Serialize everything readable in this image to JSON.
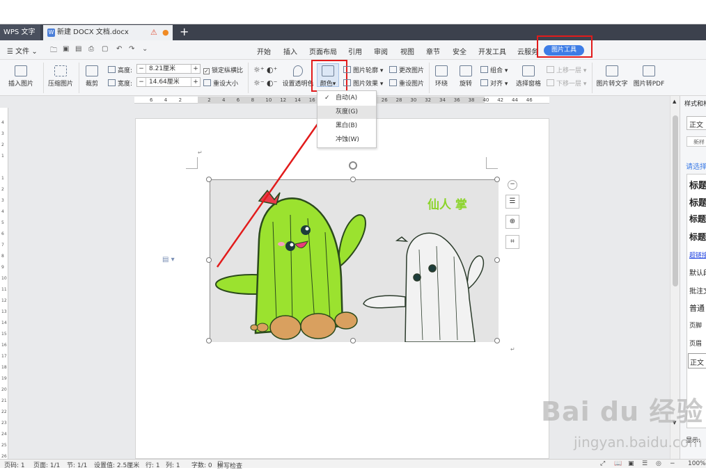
{
  "app": {
    "name": "WPS 文字"
  },
  "document_tab": {
    "title": "新建 DOCX 文档.docx",
    "icon": "W"
  },
  "menubar": {
    "file_label": "文件",
    "tabs": [
      "开始",
      "插入",
      "页面布局",
      "引用",
      "审阅",
      "视图",
      "章节",
      "安全",
      "开发工具",
      "云服务"
    ],
    "active_tab": "图片工具"
  },
  "ribbon": {
    "insert_picture": "插入图片",
    "compress_picture": "压缩图片",
    "crop": "裁剪",
    "height_label": "高度:",
    "height_value": "8.21厘米",
    "width_label": "宽度:",
    "width_value": "14.64厘米",
    "lock_ratio": "锁定纵横比",
    "reset_size": "重设大小",
    "transparent": "设置透明色",
    "color": "颜色",
    "picture_outline": "图片轮廓",
    "picture_effect": "图片效果",
    "change_picture": "更改图片",
    "reset_picture": "重设图片",
    "wrap": "环绕",
    "rotate": "旋转",
    "group": "组合",
    "align": "对齐",
    "selection_pane": "选择窗格",
    "bring_forward": "上移一层",
    "send_backward": "下移一层",
    "to_text": "图片转文字",
    "to_pdf": "图片转PDF"
  },
  "color_menu": {
    "items": [
      "自动(A)",
      "灰度(G)",
      "黑白(B)",
      "冲蚀(W)"
    ],
    "checked_index": 0,
    "highlight_index": 1
  },
  "ruler": {
    "h_ticks": [
      "6",
      "4",
      "2",
      "",
      "2",
      "4",
      "6",
      "8",
      "10",
      "12",
      "14",
      "16",
      "18",
      "20",
      "22",
      "24",
      "26",
      "28",
      "30",
      "32",
      "34",
      "36",
      "38",
      "40",
      "42",
      "44",
      "46"
    ],
    "v_ticks": [
      "4",
      "3",
      "2",
      "1",
      "",
      "1",
      "2",
      "3",
      "4",
      "5",
      "6",
      "7",
      "8",
      "9",
      "10",
      "11",
      "12",
      "13",
      "14",
      "15",
      "16",
      "17",
      "18",
      "19",
      "20",
      "21",
      "22",
      "23",
      "24",
      "25",
      "26"
    ]
  },
  "image": {
    "caption": "仙人 掌"
  },
  "right_pane": {
    "title": "样式和格",
    "style_box": "正文",
    "new_style": "新样",
    "hint": "请选择",
    "styles": [
      "标题",
      "标题",
      "标题",
      "标题",
      "超链接",
      "默认段",
      "批注文",
      "普通",
      "页脚",
      "页眉",
      "正文"
    ],
    "show_label": "显示:"
  },
  "status": {
    "page_no": "页码: 1",
    "pages": "页面: 1/1",
    "section": "节: 1/1",
    "set_value": "设置值: 2.5厘米",
    "row": "行: 1",
    "col": "列: 1",
    "words": "字数: 0",
    "spell": "拼写检查",
    "zoom": "100%"
  },
  "watermark": {
    "text": "Bai du 经验",
    "sub": "jingyan.baidu.com"
  },
  "colors": {
    "accent": "#3d7ce6",
    "highlight": "#e21b1b",
    "cactus_green": "#9be22f",
    "tab_bg": "#3c414d"
  }
}
